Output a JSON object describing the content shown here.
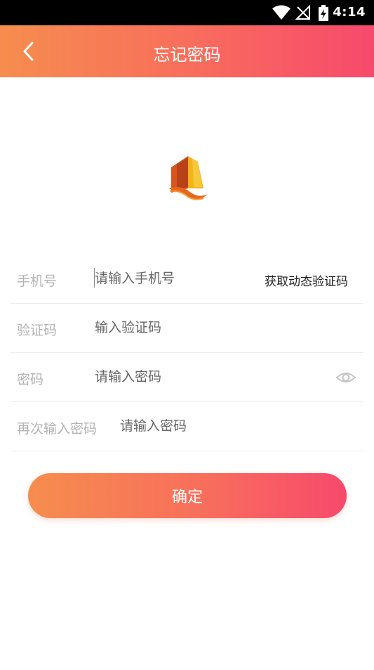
{
  "status_bar": {
    "time": "4:14"
  },
  "header": {
    "title": "忘记密码"
  },
  "form": {
    "phone": {
      "label": "手机号",
      "placeholder": "请输入手机号",
      "code_button": "获取动态验证码"
    },
    "code": {
      "label": "验证码",
      "placeholder": "输入验证码"
    },
    "password": {
      "label": "密码",
      "placeholder": "请输入密码"
    },
    "confirm_password": {
      "label": "再次输入密码",
      "placeholder": "请输入密码"
    }
  },
  "confirm_button": "确定",
  "colors": {
    "gradient_start": "#f68d4e",
    "gradient_end": "#f7496c",
    "label_gray": "#b3b3b3"
  }
}
